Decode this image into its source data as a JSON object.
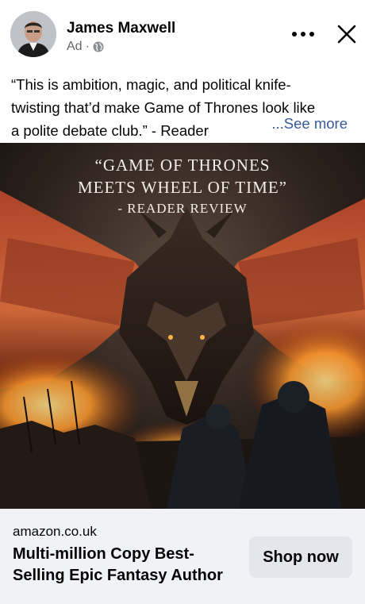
{
  "post": {
    "author": "James Maxwell",
    "ad_label": "Ad",
    "separator": "·",
    "audience_icon": "globe-icon",
    "more_icon": "more-options-icon",
    "close_icon": "close-icon",
    "text_lines": [
      "“This is ambition, magic, and political knife-",
      "twisting that’d make Game of Thrones look like",
      "a polite debate club.” - Reader"
    ],
    "see_more": "...See more"
  },
  "creative": {
    "quote_line1": "“Game of Thrones",
    "quote_line2": "meets Wheel of Time”",
    "attribution": "- Reader Review"
  },
  "cta": {
    "domain": "amazon.co.uk",
    "headline": "Multi-million Copy Best-Selling Epic Fantasy Author",
    "button_label": "Shop now"
  },
  "colors": {
    "link": "#385898",
    "secondary_text": "#65676b",
    "footer_bg": "#f0f2f5",
    "button_bg": "#e4e6eb"
  }
}
